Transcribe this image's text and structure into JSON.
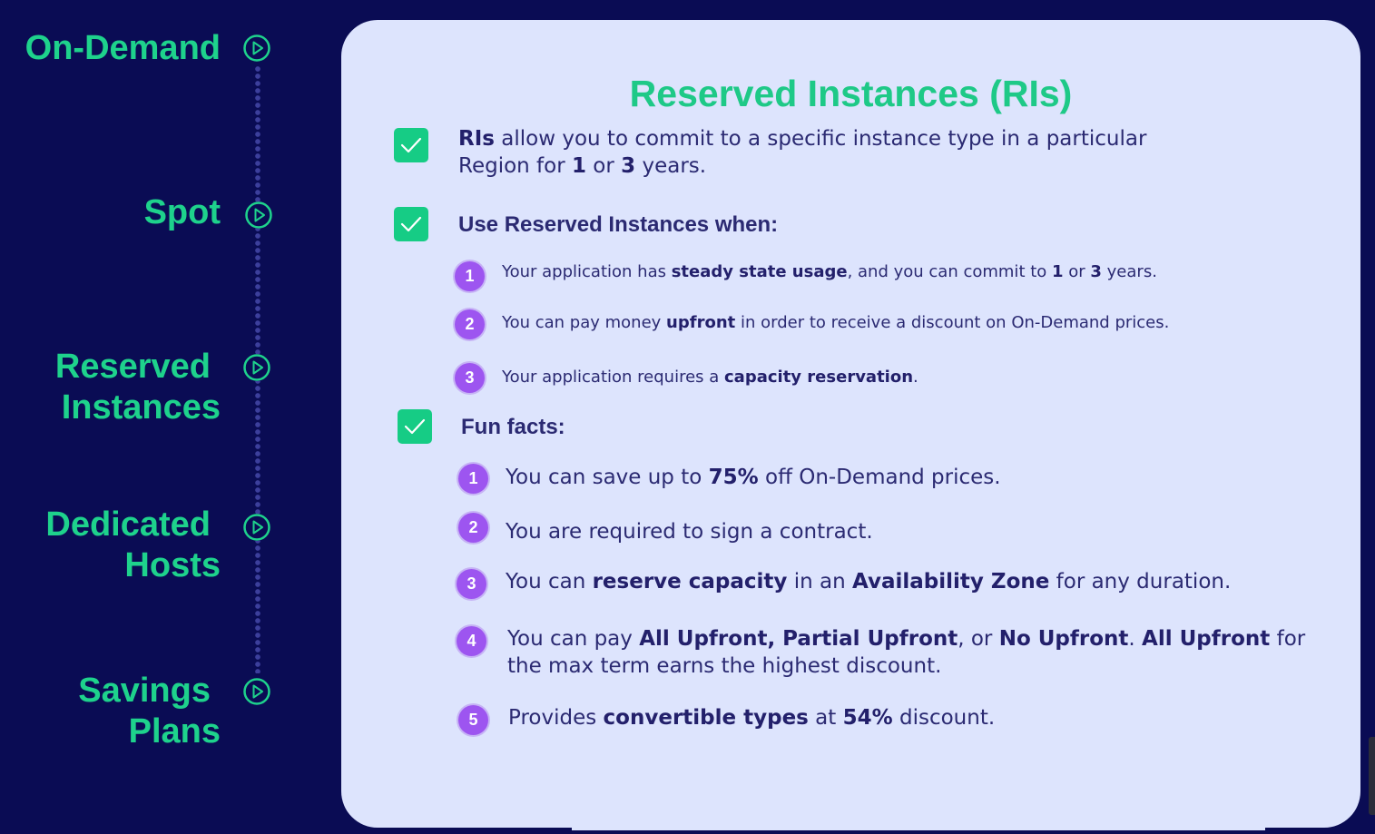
{
  "nav": {
    "items": [
      {
        "label": "On-Demand",
        "icon": "play-circle-icon"
      },
      {
        "label": "Spot",
        "icon": "play-circle-icon"
      },
      {
        "label_line1": "Reserved",
        "label_line2": "Instances",
        "icon": "play-circle-icon"
      },
      {
        "label_line1": "Dedicated",
        "label_line2": "Hosts",
        "icon": "play-circle-icon"
      },
      {
        "label_line1": "Savings",
        "label_line2": "Plans",
        "icon": "play-circle-icon"
      }
    ]
  },
  "card": {
    "title": "Reserved Instances (RIs)",
    "intro": {
      "bold1": "RIs",
      "text1": " allow you to commit to a specific instance type in a particular",
      "text2": "Region for ",
      "bold2": "1",
      "text3": " or ",
      "bold3": "3",
      "text4": " years."
    },
    "use_heading": "Use Reserved Instances when:",
    "use_items": [
      {
        "num": "1",
        "a": "Your application has ",
        "b": "steady state usage",
        "c": ", and you can commit to ",
        "d": "1",
        "e": " or ",
        "f": "3",
        "g": " years."
      },
      {
        "num": "2",
        "a": "You can pay money ",
        "b": "upfront",
        "c": " in order to receive a discount on On-Demand prices."
      },
      {
        "num": "3",
        "a": "Your application requires a ",
        "b": "capacity reservation",
        "c": "."
      }
    ],
    "fun_heading": "Fun facts:",
    "fun_items": [
      {
        "num": "1",
        "a": "You can save up to ",
        "b": "75%",
        "c": " off On-Demand prices."
      },
      {
        "num": "2",
        "a": "You are required to sign a contract."
      },
      {
        "num": "3",
        "a": "You can ",
        "b": "reserve capacity",
        "c": " in an ",
        "d": "Availability Zone",
        "e": " for any duration."
      },
      {
        "num": "4",
        "a": "You can pay ",
        "b": "All Upfront, Partial Upfront",
        "c": ", or ",
        "d": "No Upfront",
        "e": ". ",
        "f": "All Upfront",
        "g": " for",
        "line2": "the max term earns the highest discount."
      },
      {
        "num": "5",
        "a": "Provides ",
        "b": "convertible types",
        "c": " at ",
        "d": "54%",
        "e": " discount."
      }
    ]
  },
  "colors": {
    "background": "#0a0c54",
    "accent_green": "#1ed28c",
    "card": "#dde4fd",
    "number_badge": "#9d55f0",
    "check": "#16cc85"
  }
}
